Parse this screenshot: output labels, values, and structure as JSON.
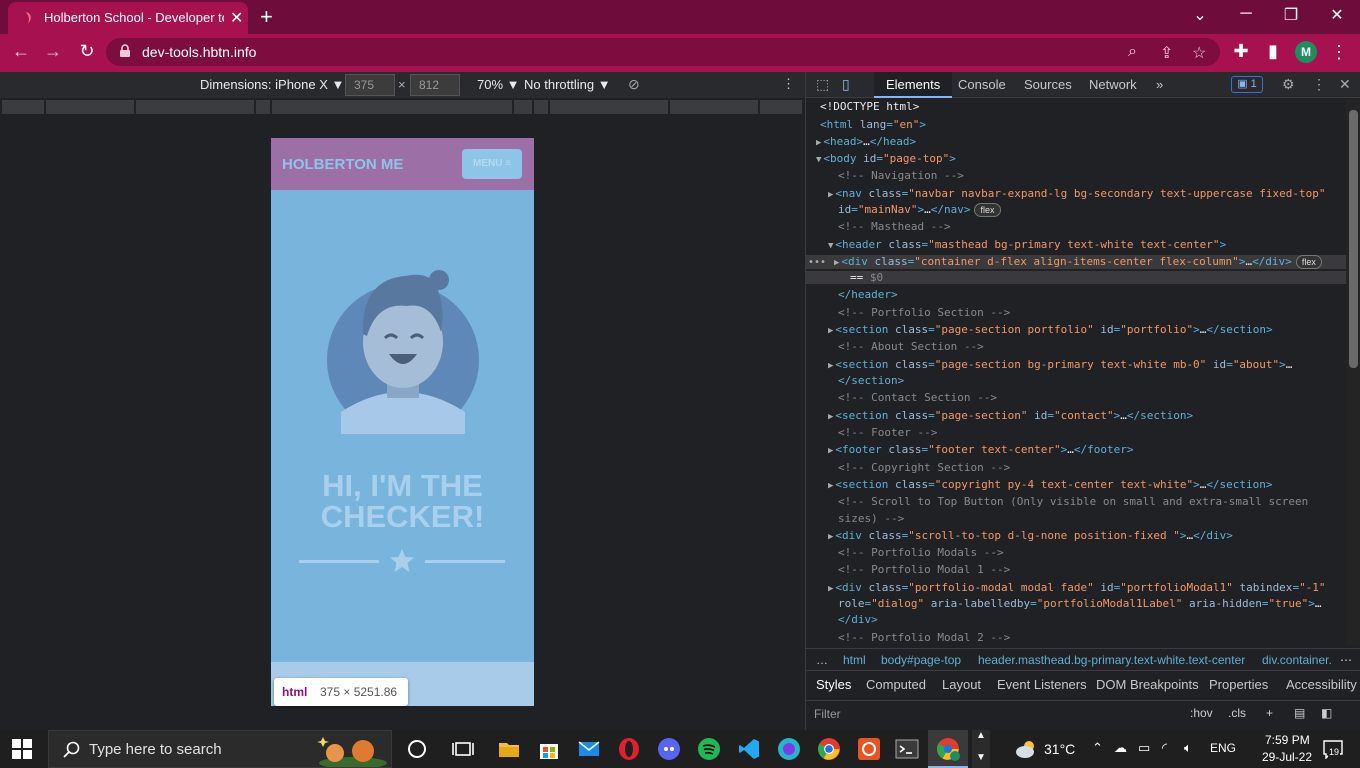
{
  "browser": {
    "tab_title": "Holberton School - Developer to",
    "new_tab": "+",
    "url": "dev-tools.hbtn.info",
    "profile_initial": "M"
  },
  "device_toolbar": {
    "dimensions_label": "Dimensions: iPhone X ▼",
    "width": "375",
    "times": "×",
    "height": "812",
    "zoom": "70% ▼",
    "throttle": "No throttling ▼"
  },
  "phone_page": {
    "brand": "HOLBERTON ME",
    "menu_button": "MENU ≡",
    "heading_line1": "HI, I'M THE",
    "heading_line2": "CHECKER!",
    "tooltip_tag": "html",
    "tooltip_dims": "375 × 5251.86"
  },
  "devtools": {
    "tabs": [
      "Elements",
      "Console",
      "Sources",
      "Network",
      "»"
    ],
    "issues_count": "1",
    "dom_lines": [
      {
        "indent": 0,
        "parts": [
          [
            "txt",
            "<!DOCTYPE html>"
          ]
        ]
      },
      {
        "indent": 0,
        "parts": [
          [
            "tag",
            "<html "
          ],
          [
            "att",
            "lang"
          ],
          [
            "tag",
            "="
          ],
          [
            "val",
            "\"en\""
          ],
          [
            "tag",
            ">"
          ]
        ]
      },
      {
        "indent": 1,
        "tri": "▶",
        "parts": [
          [
            "tag",
            "<head>"
          ],
          [
            "txt",
            "…"
          ],
          [
            "tag",
            "</head>"
          ]
        ]
      },
      {
        "indent": 1,
        "tri": "▼",
        "parts": [
          [
            "tag",
            "<body "
          ],
          [
            "att",
            "id"
          ],
          [
            "tag",
            "="
          ],
          [
            "val",
            "\"page-top\""
          ],
          [
            "tag",
            ">"
          ]
        ]
      },
      {
        "indent": 3,
        "parts": [
          [
            "cm",
            "<!-- Navigation -->"
          ]
        ]
      },
      {
        "indent": 3,
        "tri": "▶",
        "parts": [
          [
            "tag",
            "<nav "
          ],
          [
            "att",
            "class"
          ],
          [
            "tag",
            "="
          ],
          [
            "val",
            "\"navbar navbar-expand-lg bg-secondary text-uppercase fixed-top\""
          ]
        ]
      },
      {
        "indent": 3,
        "parts": [
          [
            "att",
            "id"
          ],
          [
            "tag",
            "="
          ],
          [
            "val",
            "\"mainNav\""
          ],
          [
            "tag",
            ">"
          ],
          [
            "txt",
            "…"
          ],
          [
            "tag",
            "</nav>"
          ]
        ],
        "pill": "flex"
      },
      {
        "indent": 3,
        "parts": [
          [
            "cm",
            "<!-- Masthead -->"
          ]
        ]
      },
      {
        "indent": 3,
        "tri": "▼",
        "parts": [
          [
            "tag",
            "<header "
          ],
          [
            "att",
            "class"
          ],
          [
            "tag",
            "="
          ],
          [
            "val",
            "\"masthead bg-primary text-white text-center\""
          ],
          [
            "tag",
            ">"
          ]
        ]
      },
      {
        "indent": 4,
        "tri": "▶",
        "sel": true,
        "parts": [
          [
            "tag",
            "<div "
          ],
          [
            "att",
            "class"
          ],
          [
            "tag",
            "="
          ],
          [
            "val",
            "\"container d-flex align-items-center flex-column\""
          ],
          [
            "tag",
            ">"
          ],
          [
            "txt",
            "…"
          ],
          [
            "tag",
            "</div>"
          ]
        ],
        "pill": "flex"
      },
      {
        "indent": 5,
        "sel": true,
        "parts": [
          [
            "txt",
            "== "
          ],
          [
            "cm",
            "$0"
          ]
        ]
      },
      {
        "indent": 3,
        "parts": [
          [
            "tag",
            "</header>"
          ]
        ]
      },
      {
        "indent": 3,
        "parts": [
          [
            "cm",
            "<!-- Portfolio Section -->"
          ]
        ]
      },
      {
        "indent": 3,
        "tri": "▶",
        "parts": [
          [
            "tag",
            "<section "
          ],
          [
            "att",
            "class"
          ],
          [
            "tag",
            "="
          ],
          [
            "val",
            "\"page-section portfolio\""
          ],
          [
            "att",
            " id"
          ],
          [
            "tag",
            "="
          ],
          [
            "val",
            "\"portfolio\""
          ],
          [
            "tag",
            ">"
          ],
          [
            "txt",
            "…"
          ],
          [
            "tag",
            "</section>"
          ]
        ]
      },
      {
        "indent": 3,
        "parts": [
          [
            "cm",
            "<!-- About Section -->"
          ]
        ]
      },
      {
        "indent": 3,
        "tri": "▶",
        "parts": [
          [
            "tag",
            "<section "
          ],
          [
            "att",
            "class"
          ],
          [
            "tag",
            "="
          ],
          [
            "val",
            "\"page-section bg-primary text-white mb-0\""
          ],
          [
            "att",
            " id"
          ],
          [
            "tag",
            "="
          ],
          [
            "val",
            "\"about\""
          ],
          [
            "tag",
            ">"
          ],
          [
            "txt",
            "…"
          ]
        ]
      },
      {
        "indent": 3,
        "parts": [
          [
            "tag",
            "</section>"
          ]
        ]
      },
      {
        "indent": 3,
        "parts": [
          [
            "cm",
            "<!-- Contact Section -->"
          ]
        ]
      },
      {
        "indent": 3,
        "tri": "▶",
        "parts": [
          [
            "tag",
            "<section "
          ],
          [
            "att",
            "class"
          ],
          [
            "tag",
            "="
          ],
          [
            "val",
            "\"page-section\""
          ],
          [
            "att",
            " id"
          ],
          [
            "tag",
            "="
          ],
          [
            "val",
            "\"contact\""
          ],
          [
            "tag",
            ">"
          ],
          [
            "txt",
            "…"
          ],
          [
            "tag",
            "</section>"
          ]
        ]
      },
      {
        "indent": 3,
        "parts": [
          [
            "cm",
            "<!-- Footer -->"
          ]
        ]
      },
      {
        "indent": 3,
        "tri": "▶",
        "parts": [
          [
            "tag",
            "<footer "
          ],
          [
            "att",
            "class"
          ],
          [
            "tag",
            "="
          ],
          [
            "val",
            "\"footer text-center\""
          ],
          [
            "tag",
            ">"
          ],
          [
            "txt",
            "…"
          ],
          [
            "tag",
            "</footer>"
          ]
        ]
      },
      {
        "indent": 3,
        "parts": [
          [
            "cm",
            "<!-- Copyright Section -->"
          ]
        ]
      },
      {
        "indent": 3,
        "tri": "▶",
        "parts": [
          [
            "tag",
            "<section "
          ],
          [
            "att",
            "class"
          ],
          [
            "tag",
            "="
          ],
          [
            "val",
            "\"copyright py-4 text-center text-white\""
          ],
          [
            "tag",
            ">"
          ],
          [
            "txt",
            "…"
          ],
          [
            "tag",
            "</section>"
          ]
        ]
      },
      {
        "indent": 3,
        "parts": [
          [
            "cm",
            "<!-- Scroll to Top Button (Only visible on small and extra-small screen"
          ]
        ]
      },
      {
        "indent": 3,
        "parts": [
          [
            "cm",
            "sizes) -->"
          ]
        ]
      },
      {
        "indent": 3,
        "tri": "▶",
        "parts": [
          [
            "tag",
            "<div "
          ],
          [
            "att",
            "class"
          ],
          [
            "tag",
            "="
          ],
          [
            "val",
            "\"scroll-to-top d-lg-none position-fixed \""
          ],
          [
            "tag",
            ">"
          ],
          [
            "txt",
            "…"
          ],
          [
            "tag",
            "</div>"
          ]
        ]
      },
      {
        "indent": 3,
        "parts": [
          [
            "cm",
            "<!-- Portfolio Modals -->"
          ]
        ]
      },
      {
        "indent": 3,
        "parts": [
          [
            "cm",
            "<!-- Portfolio Modal 1 -->"
          ]
        ]
      },
      {
        "indent": 3,
        "tri": "▶",
        "parts": [
          [
            "tag",
            "<div "
          ],
          [
            "att",
            "class"
          ],
          [
            "tag",
            "="
          ],
          [
            "val",
            "\"portfolio-modal modal fade\""
          ],
          [
            "att",
            " id"
          ],
          [
            "tag",
            "="
          ],
          [
            "val",
            "\"portfolioModal1\""
          ],
          [
            "att",
            " tabindex"
          ],
          [
            "tag",
            "="
          ],
          [
            "val",
            "\"-1\""
          ]
        ]
      },
      {
        "indent": 3,
        "parts": [
          [
            "att",
            "role"
          ],
          [
            "tag",
            "="
          ],
          [
            "val",
            "\"dialog\""
          ],
          [
            "att",
            " aria-labelledby"
          ],
          [
            "tag",
            "="
          ],
          [
            "val",
            "\"portfolioModal1Label\""
          ],
          [
            "att",
            " aria-hidden"
          ],
          [
            "tag",
            "="
          ],
          [
            "val",
            "\"true\""
          ],
          [
            "tag",
            ">"
          ],
          [
            "txt",
            "…"
          ]
        ]
      },
      {
        "indent": 3,
        "parts": [
          [
            "tag",
            "</div>"
          ]
        ]
      },
      {
        "indent": 3,
        "parts": [
          [
            "cm",
            "<!-- Portfolio Modal 2 -->"
          ]
        ]
      }
    ],
    "breadcrumbs": [
      "…",
      "html",
      "body#page-top",
      "header.masthead.bg-primary.text-white.text-center",
      "div.container."
    ],
    "style_tabs": [
      "Styles",
      "Computed",
      "Layout",
      "Event Listeners",
      "DOM Breakpoints",
      "Properties",
      "Accessibility"
    ],
    "filter_placeholder": "Filter",
    "filter_hov": ":hov",
    "filter_cls": ".cls"
  },
  "taskbar": {
    "search_placeholder": "Type here to search",
    "temperature": "31°C",
    "language": "ENG",
    "time": "7:59 PM",
    "date": "29-Jul-22",
    "notification_count": "19"
  },
  "colors": {
    "accent": "#a8114f",
    "tab_bar": "#6e0c3c",
    "phone_nav": "#9c6fa6",
    "phone_bg": "#78b4dc"
  }
}
